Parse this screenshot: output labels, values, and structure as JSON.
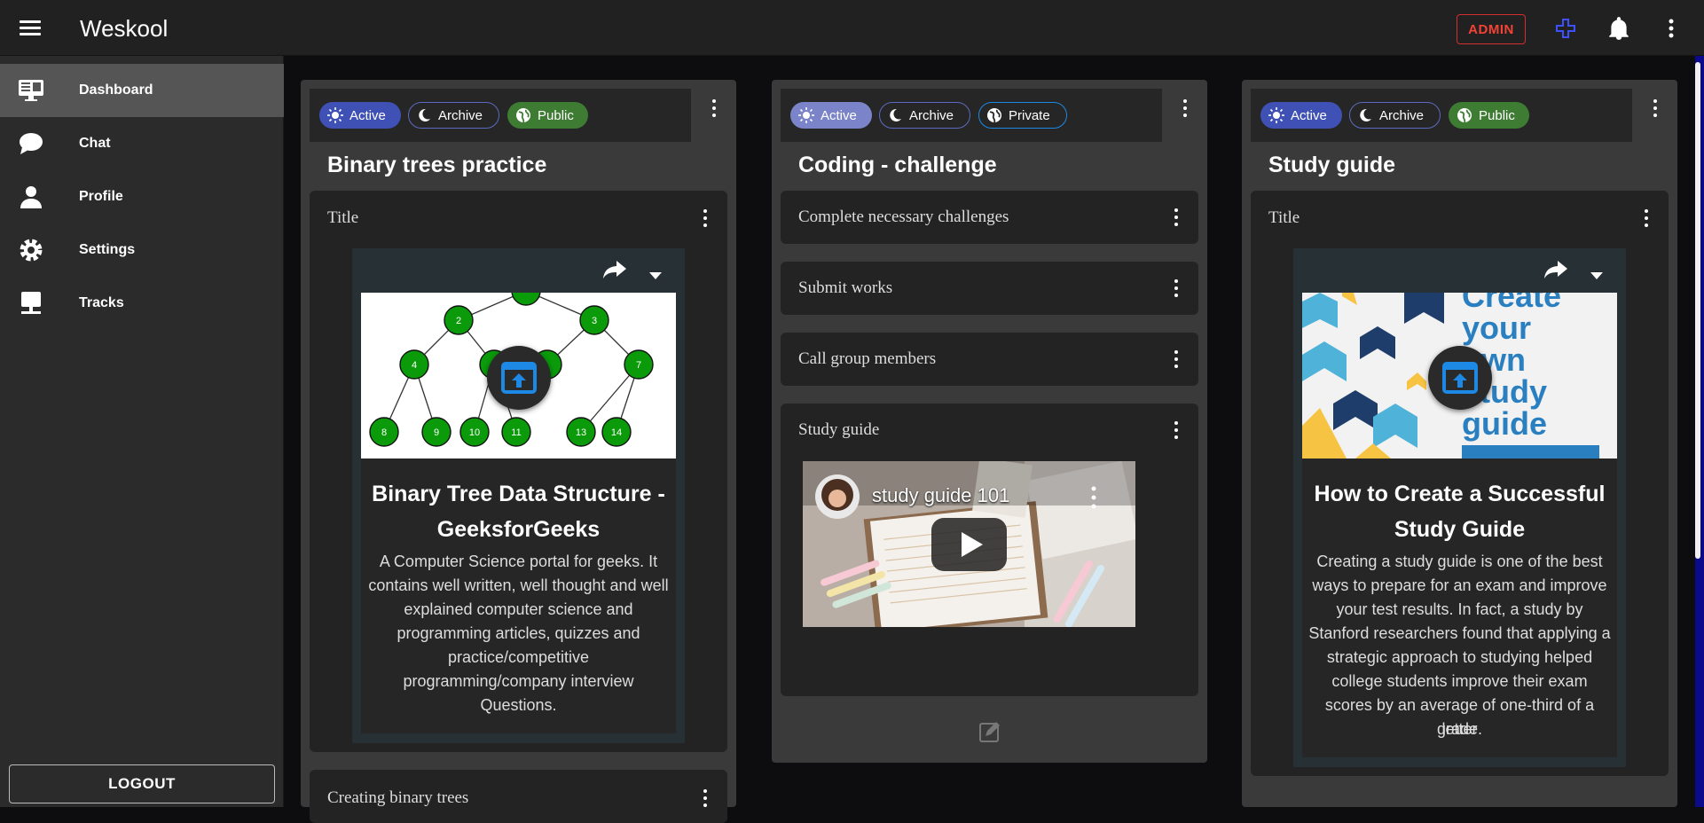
{
  "appbar": {
    "title": "Weskool",
    "admin_label": "ADMIN"
  },
  "sidebar": {
    "items": [
      {
        "label": "Dashboard",
        "icon": "monitor-icon"
      },
      {
        "label": "Chat",
        "icon": "chat-bubble-icon"
      },
      {
        "label": "Profile",
        "icon": "person-icon"
      },
      {
        "label": "Settings",
        "icon": "gear-icon"
      },
      {
        "label": "Tracks",
        "icon": "desktop-icon"
      }
    ],
    "logout_label": "LOGOUT"
  },
  "columns": [
    {
      "chips": [
        "Active",
        "Archive",
        "Public"
      ],
      "title": "Binary trees practice",
      "card_title": "Title",
      "link": {
        "title": "Binary Tree Data Structure - GeeksforGeeks",
        "desc_lines": [
          "A Computer Science portal for geeks. It",
          "contains well written, well thought and well",
          "explained computer science and",
          "programming articles, quizzes and",
          "practice/competitive",
          "programming/company interview",
          "Questions."
        ],
        "tree_nodes": [
          "2",
          "3",
          "4",
          "7",
          "8",
          "9",
          "10",
          "11",
          "13",
          "14"
        ]
      },
      "next_card_title": "Creating binary trees"
    },
    {
      "chips": [
        "Active",
        "Archive",
        "Private"
      ],
      "title": "Coding - challenge",
      "tasks": [
        "Complete necessary challenges",
        "Submit works",
        "Call group members"
      ],
      "video_card_title": "Study guide",
      "video_title": "study guide 101"
    },
    {
      "chips": [
        "Active",
        "Archive",
        "Public"
      ],
      "title": "Study guide",
      "card_title": "Title",
      "link": {
        "title": "How to Create a Successful Study Guide",
        "desc_lines": [
          "Creating a study guide is one of the best",
          "ways to prepare for an exam and improve",
          "your test results. In fact, a study by",
          "Stanford researchers found that applying a",
          "strategic approach to studying helped",
          "college students improve their exam",
          "scores by an average of one-third of a letter",
          "grade."
        ],
        "preview_text": [
          "Create",
          "your",
          "own",
          "study",
          "guide"
        ]
      }
    }
  ],
  "colors": {
    "accent": "#3f51b5",
    "public": "#3d7c32",
    "admin": "#f44336"
  }
}
